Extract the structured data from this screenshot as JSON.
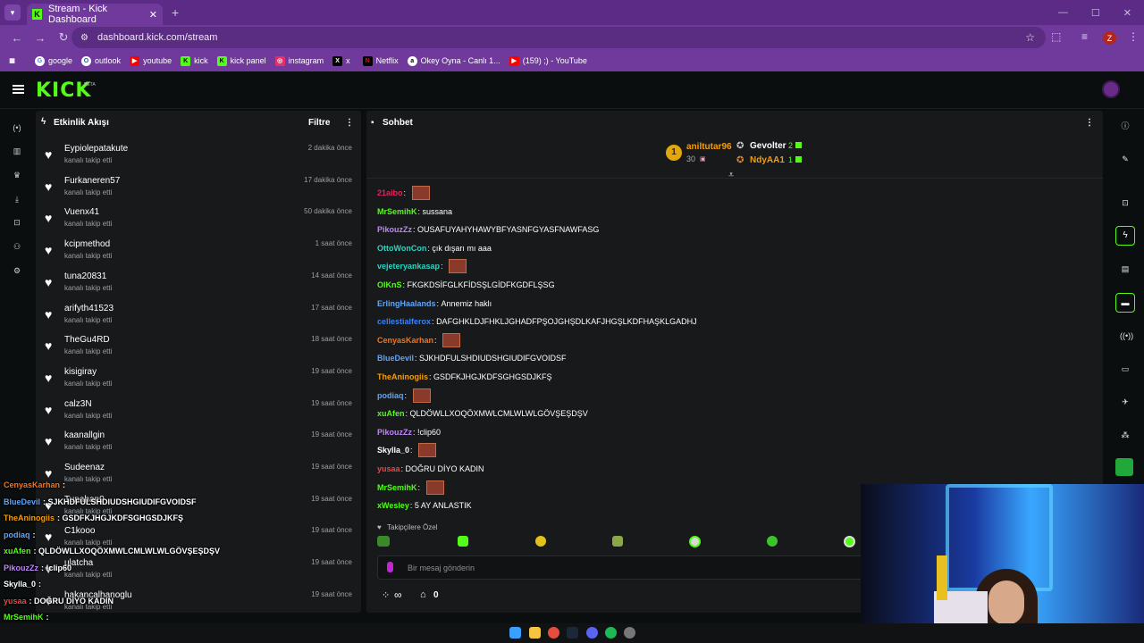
{
  "browser": {
    "tab_title": "Stream - Kick Dashboard",
    "url": "dashboard.kick.com/stream",
    "profile_initial": "Z",
    "bookmarks": [
      "google",
      "outlook",
      "youtube",
      "kick",
      "kick panel",
      "instagram",
      "x",
      "Netflix",
      "Okey Oyna - Canlı 1...",
      "(159) ;) - YouTube"
    ]
  },
  "app": {
    "logo": "KICK",
    "beta": "BETA",
    "accent": "#53fc18"
  },
  "activity": {
    "title": "Etkinlik Akışı",
    "filter_label": "Filtre",
    "events": [
      {
        "name": "Eypiolepatakute",
        "sub": "kanalı takip etti",
        "time": "2 dakika önce"
      },
      {
        "name": "Furkaneren57",
        "sub": "kanalı takip etti",
        "time": "17 dakika önce"
      },
      {
        "name": "Vuenx41",
        "sub": "kanalı takip etti",
        "time": "50 dakika önce"
      },
      {
        "name": "kcipmethod",
        "sub": "kanalı takip etti",
        "time": "1 saat önce"
      },
      {
        "name": "tuna20831",
        "sub": "kanalı takip etti",
        "time": "14 saat önce"
      },
      {
        "name": "arifyth41523",
        "sub": "kanalı takip etti",
        "time": "17 saat önce"
      },
      {
        "name": "TheGu4RD",
        "sub": "kanalı takip etti",
        "time": "18 saat önce"
      },
      {
        "name": "kisigiray",
        "sub": "kanalı takip etti",
        "time": "19 saat önce"
      },
      {
        "name": "calz3N",
        "sub": "kanalı takip etti",
        "time": "19 saat önce"
      },
      {
        "name": "kaanallgin",
        "sub": "kanalı takip etti",
        "time": "19 saat önce"
      },
      {
        "name": "Sudeenaz",
        "sub": "kanalı takip etti",
        "time": "19 saat önce"
      },
      {
        "name": "Tunahan0",
        "sub": "kanalı takip etti",
        "time": "19 saat önce"
      },
      {
        "name": "C1kooo",
        "sub": "kanalı takip etti",
        "time": "19 saat önce"
      },
      {
        "name": "ulatcha",
        "sub": "kanalı takip etti",
        "time": "19 saat önce"
      },
      {
        "name": "hakancalhanoglu",
        "sub": "kanalı takip etti",
        "time": "19 saat önce"
      }
    ]
  },
  "chat": {
    "title": "Sohbet",
    "leaderboard": [
      {
        "rank": "1",
        "name": "aniltutar96",
        "count": "30"
      },
      {
        "name": "Gevolter",
        "count": "2"
      },
      {
        "name": "NdyAA1",
        "count": "1"
      }
    ],
    "messages": [
      {
        "user": "21aibo",
        "text": "",
        "color": "#e0245e",
        "emote": true
      },
      {
        "user": "MrSemihK",
        "text": "sussana",
        "color": "#53fc18"
      },
      {
        "user": "PikouzZz",
        "text": "OUSAFUYAHYHAWYBFYASNFGYASFNAWFASG",
        "color": "#c084fc"
      },
      {
        "user": "OttoWonCon",
        "text": "çık dışarı mı aaa",
        "color": "#2dd4bf"
      },
      {
        "user": "vejeteryankasap",
        "text": "",
        "color": "#2dd4bf",
        "emote": true
      },
      {
        "user": "OlKnS",
        "text": "FKGKDSİFGLKFİDSŞLGİDFKGDFLŞSG",
        "color": "#53fc18"
      },
      {
        "user": "ErlingHaalands",
        "text": "Annemiz haklı",
        "color": "#60a5fa"
      },
      {
        "user": "cellestialferox",
        "text": "DAFGHKLDJFHKLJGHADFPŞOJGHŞDLKAFJHGŞLKDFHAŞKLGADHJ",
        "color": "#3b82f6"
      },
      {
        "user": "CenyasKarhan",
        "text": "",
        "color": "#f97316",
        "emote": true
      },
      {
        "user": "BlueDevil",
        "text": "SJKHDFULSHDIUDSHGIUDIFGVOIDSF",
        "color": "#60a5fa"
      },
      {
        "user": "TheAninogiis",
        "text": "GSDFKJHGJKDFSGHGSDJKFŞ",
        "color": "#f59e0b"
      },
      {
        "user": "podiaq",
        "text": "",
        "color": "#60a5fa",
        "emote": true
      },
      {
        "user": "xuAfen",
        "text": "QLDÖWLLXOQÖXMWLCMLWLWLGÖVŞEŞDŞV",
        "color": "#53fc18"
      },
      {
        "user": "PikouzZz",
        "text": "!clip60",
        "color": "#c084fc"
      },
      {
        "user": "Skylla_0",
        "text": "",
        "color": "#ffffff",
        "emote": true
      },
      {
        "user": "yusaa",
        "text": "DOĞRU DİYO KADIN",
        "color": "#ef4444"
      },
      {
        "user": "MrSemihK",
        "text": "",
        "color": "#53fc18",
        "emote": true
      },
      {
        "user": "xWesley",
        "text": "5 AY ANLASTIK",
        "color": "#53fc18"
      }
    ],
    "followers_only": "Takipçilere Özel",
    "input_placeholder": "Bir mesaj gönderin",
    "points": "∞",
    "store_count": "0"
  },
  "overlay": {
    "messages": [
      {
        "user": "CenyasKarhan",
        "text": ":",
        "color": "#f97316"
      },
      {
        "user": "BlueDevil",
        "text": ": SJKHDFULSHDIUDSHGIUDIFGVOIDSF",
        "color": "#60a5fa"
      },
      {
        "user": "TheAninogiis",
        "text": ": GSDFKJHGJKDFSGHGSDJKFŞ",
        "color": "#f59e0b"
      },
      {
        "user": "podiaq",
        "text": ":",
        "color": "#60a5fa"
      },
      {
        "user": "xuAfen",
        "text": ": QLDÖWLLXOQÖXMWLCMLWLWLGÖVŞEŞDŞV",
        "color": "#53fc18"
      },
      {
        "user": "PikouzZz",
        "text": ": !clip60",
        "color": "#c084fc"
      },
      {
        "user": "Skylla_0",
        "text": ":",
        "color": "#ffffff"
      },
      {
        "user": "yusaa",
        "text": ": DOĞRU DİYO KADIN",
        "color": "#ef4444"
      },
      {
        "user": "MrSemihK",
        "text": ":",
        "color": "#53fc18"
      },
      {
        "user": "xWesley",
        "text": ": 5 AY ANLASTIK",
        "color": "#53fc18"
      }
    ]
  }
}
